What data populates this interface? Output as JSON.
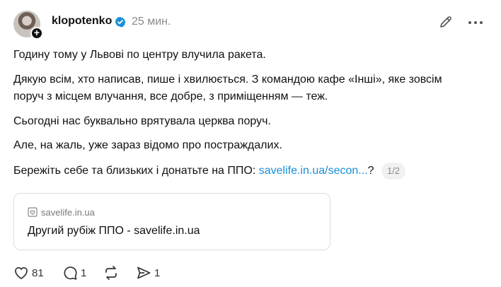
{
  "post": {
    "username": "klopotenko",
    "time": "25 мин.",
    "paragraphs": [
      "Годину тому у Львові по центру влучила ракета.",
      "Дякую всім, хто написав, пише і хвилюється. З командою кафе «Інші», яке зовсім",
      "поруч з місцем влучання, все добре, з приміщенням — теж.",
      "Сьогодні нас буквально врятувала церква поруч.",
      "Але, на жаль, уже зараз відомо про постраждалих."
    ],
    "last_line_prefix": "Бережіть себе та близьких і донатьте на ППО: ",
    "last_line_link": "savelife.in.ua/secon...",
    "last_line_suffix": "?",
    "pager": "1/2"
  },
  "link_card": {
    "domain": "savelife.in.ua",
    "title": "Другий рубіж ППО - savelife.in.ua"
  },
  "actions": {
    "likes": "81",
    "replies": "1",
    "shares": "1"
  },
  "icons": {
    "verified": "verified-badge-icon",
    "edit": "pencil-icon",
    "more": "more-dots-icon",
    "like": "heart-icon",
    "reply": "comment-icon",
    "repost": "repost-icon",
    "share": "send-icon"
  },
  "colors": {
    "link": "#1a8fd6",
    "verified": "#1a8fd6",
    "muted": "#8a8a8a"
  }
}
